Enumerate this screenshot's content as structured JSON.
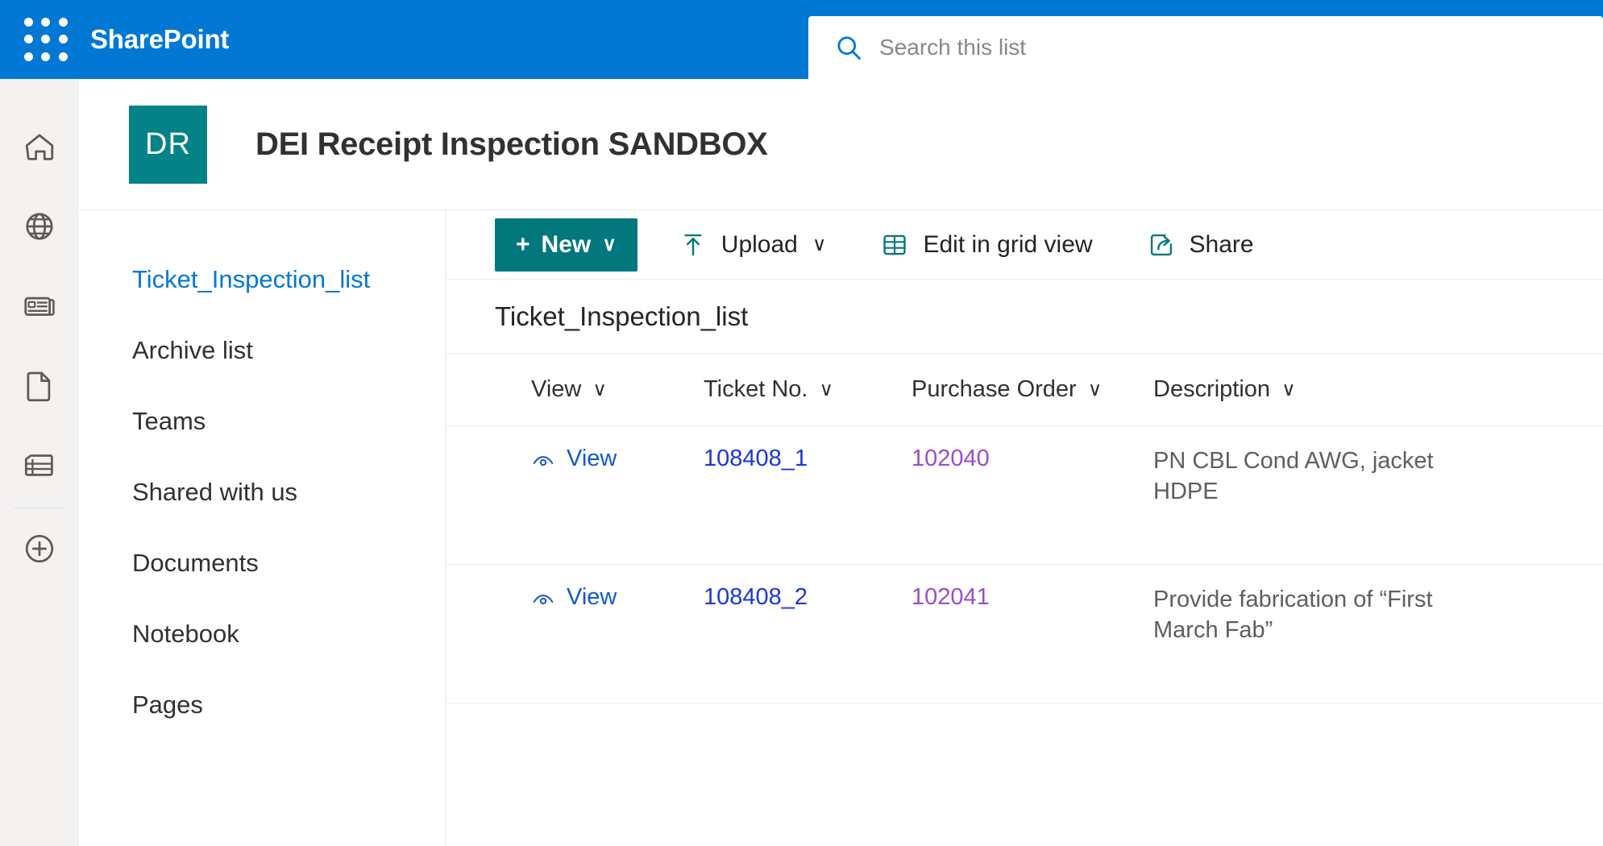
{
  "suite": {
    "brand": "SharePoint",
    "waffle_icon": "waffle-grid-icon",
    "search": {
      "placeholder": "Search this list",
      "value": "",
      "icon": "search-icon"
    }
  },
  "app_rail": {
    "items": [
      {
        "name": "home",
        "icon": "home-icon"
      },
      {
        "name": "my-sites",
        "icon": "globe-icon"
      },
      {
        "name": "news",
        "icon": "news-icon"
      },
      {
        "name": "files",
        "icon": "document-icon"
      },
      {
        "name": "lists",
        "icon": "lists-icon"
      }
    ],
    "create": {
      "name": "create",
      "icon": "plus-circle-icon"
    }
  },
  "site": {
    "logo_initials": "DR",
    "logo_color": "#038387",
    "title": "DEI Receipt Inspection SANDBOX"
  },
  "left_nav": {
    "items": [
      {
        "label": "Ticket_Inspection_list",
        "selected": true
      },
      {
        "label": "Archive list",
        "selected": false
      },
      {
        "label": "Teams",
        "selected": false
      },
      {
        "label": "Shared with us",
        "selected": false
      },
      {
        "label": "Documents",
        "selected": false
      },
      {
        "label": "Notebook",
        "selected": false
      },
      {
        "label": "Pages",
        "selected": false
      }
    ]
  },
  "command_bar": {
    "new_label": "New",
    "new_plus": "+",
    "new_chevron": "∨",
    "upload_label": "Upload",
    "upload_chevron": "∨",
    "upload_icon": "upload-icon",
    "grid_label": "Edit in grid view",
    "grid_icon": "grid-icon",
    "share_label": "Share",
    "share_icon": "share-icon"
  },
  "list": {
    "title": "Ticket_Inspection_list",
    "columns": [
      {
        "label": "View",
        "chevron": "∨"
      },
      {
        "label": "Ticket No.",
        "chevron": "∨"
      },
      {
        "label": "Purchase Order",
        "chevron": "∨"
      },
      {
        "label": "Description",
        "chevron": "∨"
      }
    ],
    "rows": [
      {
        "view_label": "View",
        "view_icon": "eye-icon",
        "ticket_no": "108408_1",
        "purchase_order": "102040",
        "description": "PN CBL Cond AWG, jacket HDPE"
      },
      {
        "view_label": "View",
        "view_icon": "eye-icon",
        "ticket_no": "108408_2",
        "purchase_order": "102041",
        "description": "Provide fabrication of “First March Fab”"
      }
    ]
  },
  "colors": {
    "suite_blue": "#0078d4",
    "teal": "#03787c",
    "link_blue": "#1a35e0",
    "visited_purple": "#9b4dca"
  }
}
